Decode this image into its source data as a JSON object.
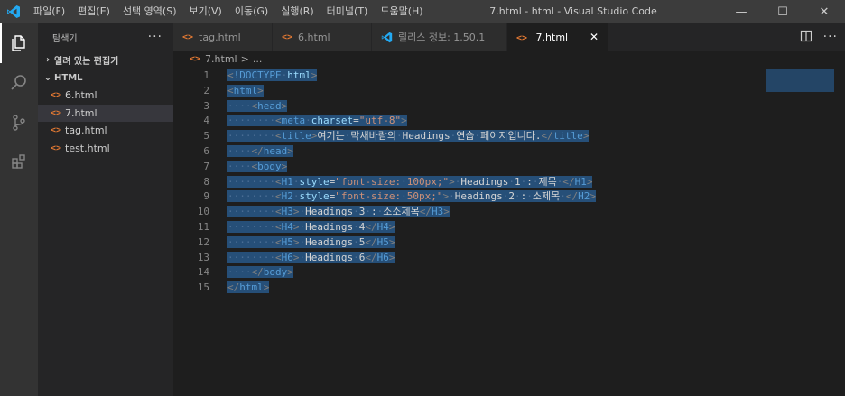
{
  "titlebar": {
    "menu": [
      "파일(F)",
      "편집(E)",
      "선택 영역(S)",
      "보기(V)",
      "이동(G)",
      "실행(R)",
      "터미널(T)",
      "도움말(H)"
    ],
    "title": "7.html - html - Visual Studio Code",
    "minimize": "—",
    "maximize": "☐",
    "close": "✕"
  },
  "sidebar": {
    "title": "탐색기",
    "more": "···",
    "open_editors": "열려 있는 편집기",
    "folder": "HTML",
    "files": [
      "6.html",
      "7.html",
      "tag.html",
      "test.html"
    ],
    "selected_file": "7.html"
  },
  "tabs": [
    {
      "label": "tag.html",
      "icon": "html-icon"
    },
    {
      "label": "6.html",
      "icon": "html-icon"
    },
    {
      "label": "릴리스 정보: 1.50.1",
      "icon": "vscode-icon"
    },
    {
      "label": "7.html",
      "icon": "html-icon",
      "active": true
    }
  ],
  "tab_close": "✕",
  "breadcrumb": {
    "file": "7.html",
    "sep": ">",
    "rest": "..."
  },
  "editor": {
    "line_numbers": [
      "1",
      "2",
      "3",
      "4",
      "5",
      "6",
      "7",
      "8",
      "9",
      "10",
      "11",
      "12",
      "13",
      "14",
      "15"
    ],
    "lines": [
      "<!DOCTYPE html>",
      "<html>",
      "    <head>",
      "        <meta charset=\"utf-8\">",
      "        <title>여기는 막새바람의 Headings 연습 페이지입니다.</title>",
      "    </head>",
      "    <body>",
      "        <H1 style=\"font-size: 100px;\"> Headings 1 : 제목 </H1>",
      "        <H2 style=\"font-size: 50px;\"> Headings 2 : 소제목 </H2>",
      "        <H3> Headings 3 : 소소제목</H3>",
      "        <H4> Headings 4</H4>",
      "        <H5> Headings 5</H5>",
      "        <H6> Headings 6</H6>",
      "    </body>",
      "</html>"
    ]
  },
  "colors": {
    "selection": "#264f78",
    "tag": "#569cd6",
    "attr": "#9cdcfe",
    "string": "#ce9178",
    "text": "#d4d4d4",
    "html_icon": "#e37933",
    "vscode_blue": "#23a9f2"
  }
}
